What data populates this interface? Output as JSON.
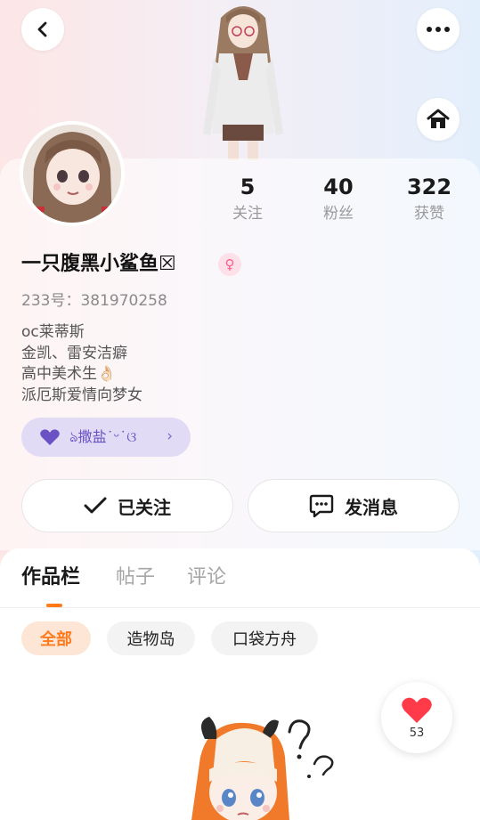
{
  "header": {
    "back_icon": "chevron-left-icon",
    "more_icon": "more-dots-icon",
    "home_icon": "home-icon"
  },
  "profile": {
    "name": "一只腹黑小鲨鱼☒",
    "gender_symbol": "♀",
    "uid_label": "233号：",
    "uid_value": "381970258",
    "bio_lines": [
      "oc莱蒂斯",
      "金凯、雷安洁癖",
      "高中美术生👌🏻",
      "派厄斯爱情向梦女"
    ],
    "medal_text": "ঌ撒盐˙ᵕ˙ଓ",
    "medal_chevron": "›"
  },
  "stats": [
    {
      "value": "5",
      "label": "关注"
    },
    {
      "value": "40",
      "label": "粉丝"
    },
    {
      "value": "322",
      "label": "获赞"
    }
  ],
  "actions": {
    "follow_label": "已关注",
    "message_label": "发消息"
  },
  "tabs": [
    "作品栏",
    "帖子",
    "评论"
  ],
  "filters": [
    "全部",
    "造物岛",
    "口袋方舟"
  ],
  "like_float": {
    "count": "53"
  },
  "colors": {
    "accent": "#ff7a1a",
    "gender_pink": "#ff5c8a",
    "medal_purple": "#6a52c4",
    "like_red": "#ff3b4a"
  }
}
